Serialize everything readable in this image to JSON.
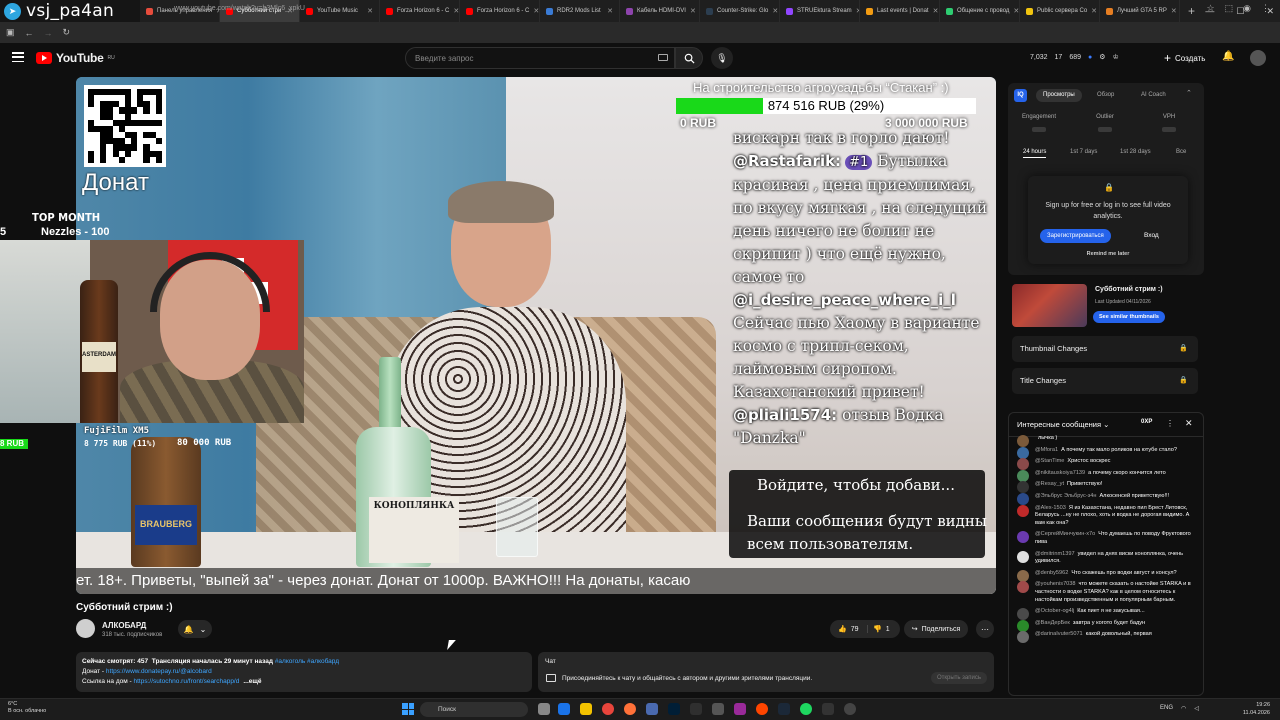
{
  "browser": {
    "tabs": [
      {
        "label": "Панель управления",
        "color": "#e74c3c"
      },
      {
        "label": "Субботний стри",
        "color": "#ff0000",
        "active": true
      },
      {
        "label": "YouTube Music",
        "color": "#ff0000"
      },
      {
        "label": "Forza Horizon 6 - C",
        "color": "#ff0000"
      },
      {
        "label": "Forza Horizon 6 - C",
        "color": "#ff0000"
      },
      {
        "label": "RDR2 Mods List",
        "color": "#3a7bd5"
      },
      {
        "label": "Кабель HDMI-DVI",
        "color": "#8e44ad"
      },
      {
        "label": "Counter-Strike: Glo",
        "color": "#2c3e50"
      },
      {
        "label": "STRUEktura Stream",
        "color": "#9146ff"
      },
      {
        "label": "Last events | Donat",
        "color": "#f39c12"
      },
      {
        "label": "Общение с провод",
        "color": "#2ecc71"
      },
      {
        "label": "Public сервера Co",
        "color": "#f1c40f"
      },
      {
        "label": "Лучший GTA 5 RP",
        "color": "#e67e22"
      }
    ],
    "url": "www.youtube.com/watch?v=b3Mlc6_xpkU",
    "telegram_name": "vsj_pa4an"
  },
  "masthead": {
    "logo": "YouTube",
    "region": "RU",
    "search_placeholder": "Введите запрос",
    "stats": [
      "7,032",
      "17",
      "689"
    ],
    "create_label": "Создать"
  },
  "video": {
    "qr_label": "Донат",
    "fund": {
      "title": "На строительство агроусадьбы “Стакан” :)",
      "amount": "874 516 RUB (29%)",
      "progress": 0.29,
      "min": "0 RUB",
      "max": "3 000 000 RUB"
    },
    "donations": [
      {
        "text": "вискарн так в горло дают!"
      },
      {
        "user": "@Rastafarik:",
        "rank": "#1",
        "text": "Бутылка\nкрасивая , цена приемлимая,\nпо вкусу мягкая , на следущий\nдень ничего не болит не\nскрипит ) что ещё нужно,\nсамое то"
      },
      {
        "user": "@i_desire_peace_where_i_l",
        "text": "Сейчас пью Хаому в варианте\nкосмо с трипл-секом,\nлаймовым сиропом.\nКазахстанский привет!"
      },
      {
        "user": "@pliali1574:",
        "text": "отзыв Водка\n\"Danzka\""
      }
    ],
    "login_prompt": {
      "title": "Войдите, чтобы добави...",
      "body": "Ваши сообщения будут видны всем пользователям."
    },
    "ticker": "ет.   18+. Приветы, \"выпей за\" - через донат. Донат от 1000р.  ВАЖНО!!! На донаты, касаю",
    "bottle_label": "КОНОПЛЯНКА",
    "beer_label": "BRAUBERG",
    "top_month_label": "TOP MONTH",
    "top_month_name": "Nezzles - 100",
    "top_month_n": "5",
    "cam_label": "FujiFilm XM5",
    "goal_fill_label": "8 RUB",
    "goal_current": "8 775 RUB (11%)",
    "goal_max": "80 000 RUB",
    "goal_progress": 0.11
  },
  "watch": {
    "title": "Субботний стрим :)",
    "channel": "АЛКОБАРД",
    "subscribers": "318 тыс. подписчиков",
    "likes": "79",
    "dislikes": "1",
    "share_label": "Поделиться",
    "description": {
      "viewers": "Сейчас смотрят: 457",
      "started": "Трансляция началась 29 минут назад",
      "tags": "#алкоголь #алкобард",
      "donate_label": "Донат - ",
      "donate_link": "https://www.donatepay.ru/@alcobard",
      "house_label": "Ссылка на дом - ",
      "house_link": "https://sutochno.ru/front/searchapp/d",
      "more": "...ещё"
    },
    "chat_card": {
      "header": "Чат",
      "text": "Присоединяйтесь к чату и общайтесь с автором и другими зрителями трансляции.",
      "open": "Открыть запись"
    }
  },
  "vidiq": {
    "tabs": [
      "Просмотры",
      "Обзор",
      "AI Coach"
    ],
    "cols": [
      "Engagement",
      "Outlier",
      "VPH"
    ],
    "ranges": [
      "24 hours",
      "1st 7 days",
      "1st 28 days",
      "Все"
    ],
    "gate_text": "Sign up for free or log in to see full video analytics.",
    "signup": "Зарегистрироваться",
    "login": "Вход",
    "later": "Remind me later",
    "thumb_title": "Субботний стрим :)",
    "thumb_date": "Last Updated 04/11/2026",
    "similar": "See similar thumbnails",
    "locked": [
      "Thumbnail Changes",
      "Title Changes"
    ]
  },
  "livechat": {
    "title": "Интересные сообщения",
    "xp": "0XP",
    "messages": [
      {
        "author": "",
        "text": "лычка )",
        "color": "#7b5a3a"
      },
      {
        "author": "@Mfora1",
        "text": "А почему так мало роликов на ютубе стало?",
        "color": "#3a6aa0"
      },
      {
        "author": "@StanTime",
        "text": "Христос воскрес",
        "color": "#8a4a4a"
      },
      {
        "author": "@nikitauskoiya7139",
        "text": "а почему скоро кончится лето",
        "color": "#4a8a5a"
      },
      {
        "author": "@Resay_yt",
        "text": "Приветствую!",
        "color": "#333333"
      },
      {
        "author": "@Эльбрус Эльбрус-з4н",
        "text": "Алкосенсей приветствую!!!",
        "color": "#2a4a8a"
      },
      {
        "author": "@Alex-1503",
        "text": "Я из Казахстана, недавно пил Брест Литовск, Беларусь ...ну не плохо, хоть и водка не дорогая видимо. А вам как она?",
        "color": "#c02a2a"
      },
      {
        "author": "@СергейМинчукин-x7o",
        "text": "Что думаешь по поводу Фруктового пива",
        "color": "#6a3ab0"
      },
      {
        "author": "@dmitrinm1397",
        "text": "увидел на днях виски коноплянка, очень удивился.",
        "color": "#e0e0e0"
      },
      {
        "author": "@denby5962",
        "text": "Что скажешь про водки август и консул?",
        "color": "#8a6a4a"
      },
      {
        "author": "@youhenis7038",
        "text": "что можете сказать о настойке STARKA и в частности о водке STARKA? как в целом относитесь к настойкам произведственным и популярным барным.",
        "color": "#a04a4a"
      },
      {
        "author": "@October-og4lj",
        "text": "Как пиет я не закусывая...",
        "color": "#4a4a4a"
      },
      {
        "author": "@ВанДерБек",
        "text": "завтра у когото будет бадун",
        "color": "#2a8a2a"
      },
      {
        "author": "@darinaIvuter5071",
        "text": "какой довольный, первая",
        "color": "#6a6a6a"
      }
    ]
  },
  "taskbar": {
    "weather_temp": "6°C",
    "weather_desc": "В осн. облачно",
    "search": "Поиск",
    "lang": "ENG",
    "time": "19:26",
    "date": "11.04.2026"
  }
}
